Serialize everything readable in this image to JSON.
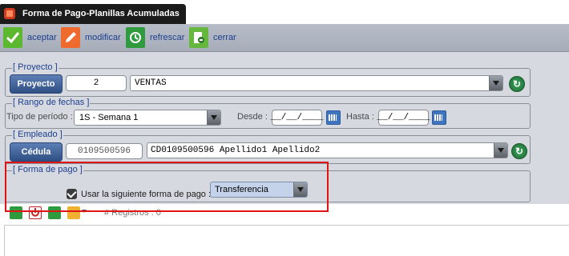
{
  "window": {
    "title": "Forma de Pago-Planillas Acumuladas"
  },
  "toolbar": {
    "accept_label": "aceptar",
    "modify_label": "modificar",
    "refresh_label": "refrescar",
    "close_label": "cerrar"
  },
  "proyecto": {
    "legend": "[ Proyecto ]",
    "button_label": "Proyecto",
    "code": "2",
    "name": "VENTAS"
  },
  "rango": {
    "legend": "[ Rango de fechas ]",
    "tipo_label": "Tipo de período :",
    "tipo_value": "1S - Semana 1",
    "desde_label": "Desde :",
    "desde_value": "__/__/____",
    "hasta_label": "Hasta :",
    "hasta_value": "__/__/____"
  },
  "empleado": {
    "legend": "[ Empleado ]",
    "button_label": "Cédula",
    "cedula": "0109500596",
    "name": "CD0109500596 Apellido1 Apellido2"
  },
  "forma_pago": {
    "legend": "[ Forma de pago ]",
    "checkbox_label": "Usar la siguiente forma de pago :",
    "checked": true,
    "selected": "Transferencia"
  },
  "grid": {
    "records_text": "# Registros : 0"
  },
  "colors": {
    "accent": "#2f4f84",
    "form_bg": "#d6dae0",
    "highlight": "#e01414"
  }
}
